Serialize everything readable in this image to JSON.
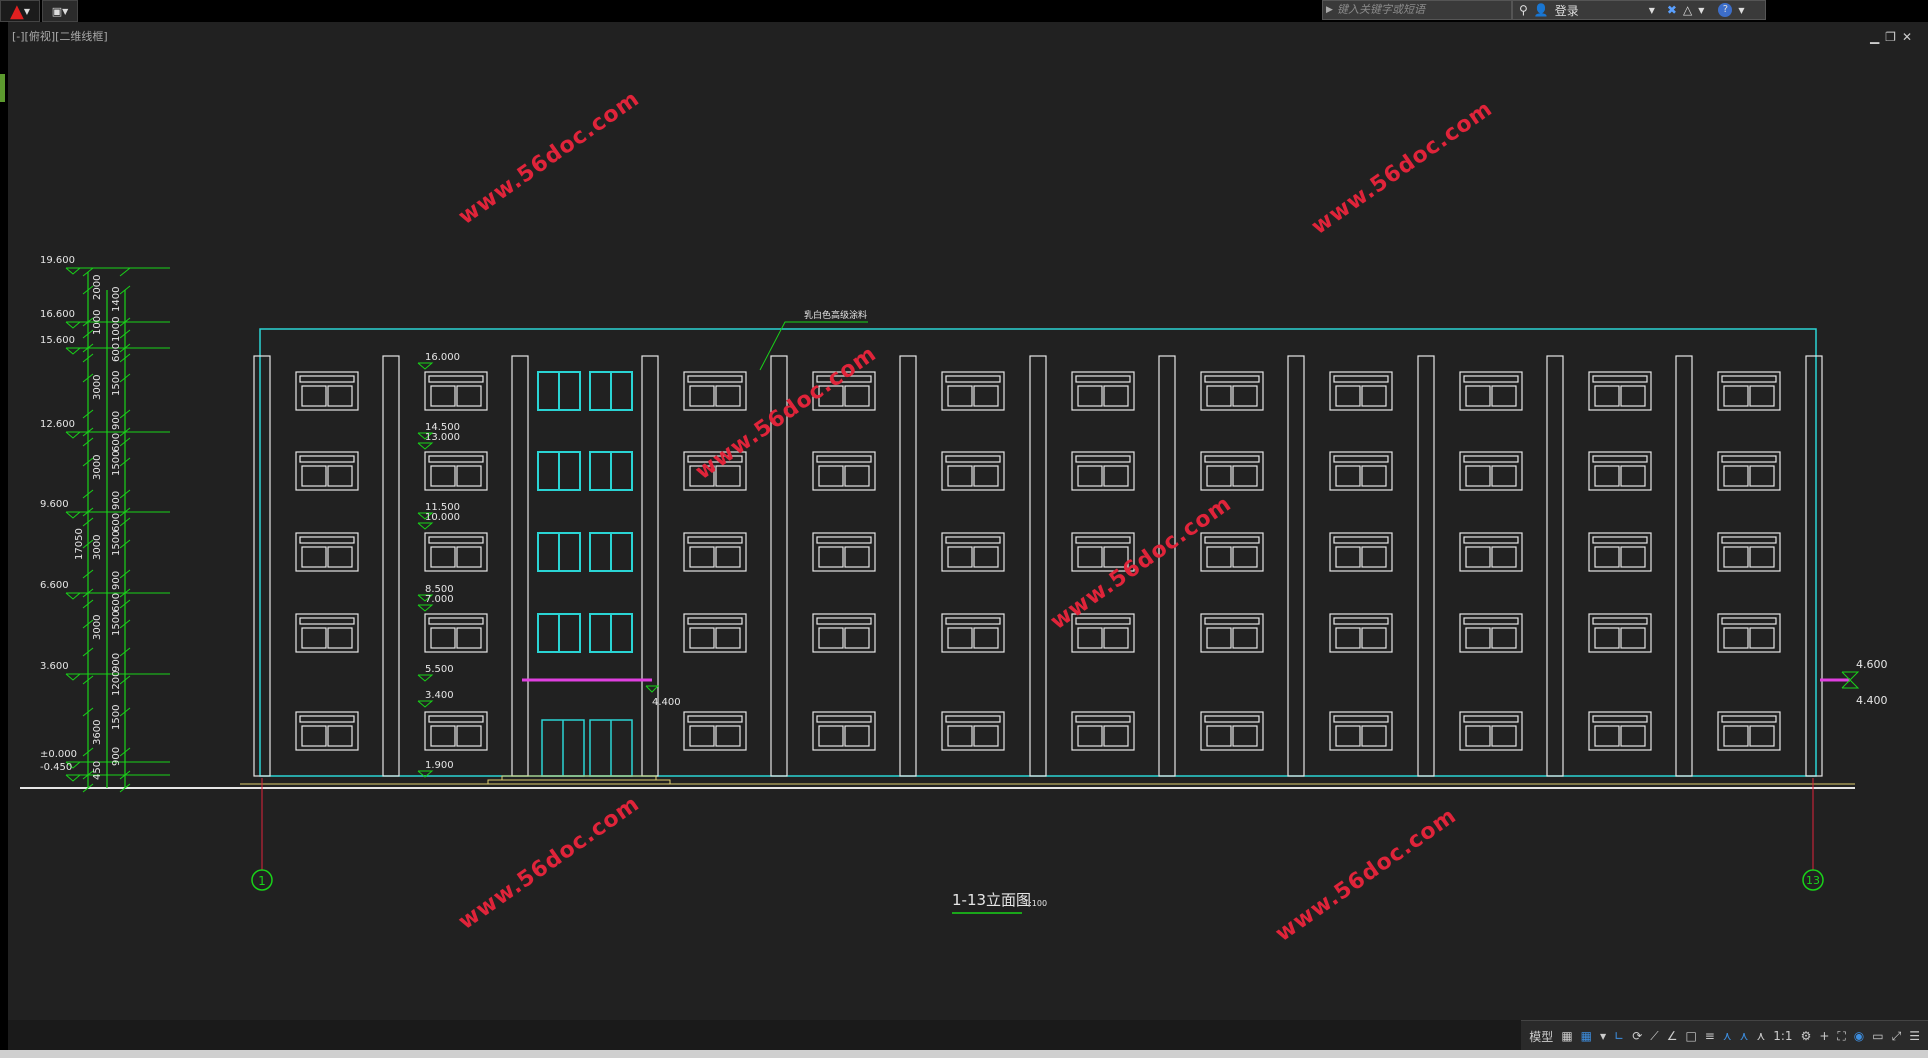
{
  "view_label": "[-][俯视][二维线框]",
  "search": {
    "placeholder": "键入关键字或短语"
  },
  "user": {
    "login_label": "登录"
  },
  "drawing": {
    "annotation": "乳白色高级涂料",
    "title": "1-13立面图",
    "scale": "1:100",
    "axis_left": "1",
    "axis_right": "13",
    "watermark": "www.56doc.com",
    "level_labels": [
      "19.600",
      "16.600",
      "15.600",
      "12.600",
      "9.600",
      "6.600",
      "3.600",
      "±0.000",
      "-0.450"
    ],
    "dim_outer": [
      "2000",
      "1000",
      "3000",
      "3000",
      "3000",
      "3000",
      "3600",
      "450",
      "17050"
    ],
    "dim_inner": [
      "1400",
      "1000",
      "600",
      "1500",
      "900",
      "600",
      "1500",
      "900",
      "600",
      "1500",
      "900",
      "600",
      "1500",
      "900",
      "1200",
      "1500",
      "900"
    ],
    "window_levels": [
      "16.000",
      "14.500",
      "13.000",
      "11.500",
      "10.000",
      "8.500",
      "7.000",
      "5.500",
      "3.400",
      "1.900"
    ],
    "canopy_level": "4.400",
    "right_levels": [
      "4.600",
      "4.400"
    ]
  },
  "statusbar": {
    "model_label": "模型",
    "scale_label": "1:1"
  },
  "colors": {
    "canvas": "#212121",
    "green": "#19d219",
    "cyan": "#2ad4d4",
    "white": "#e6e6e6",
    "magenta": "#e040e0",
    "red": "#e0243a",
    "yellow": "#e0d070"
  }
}
